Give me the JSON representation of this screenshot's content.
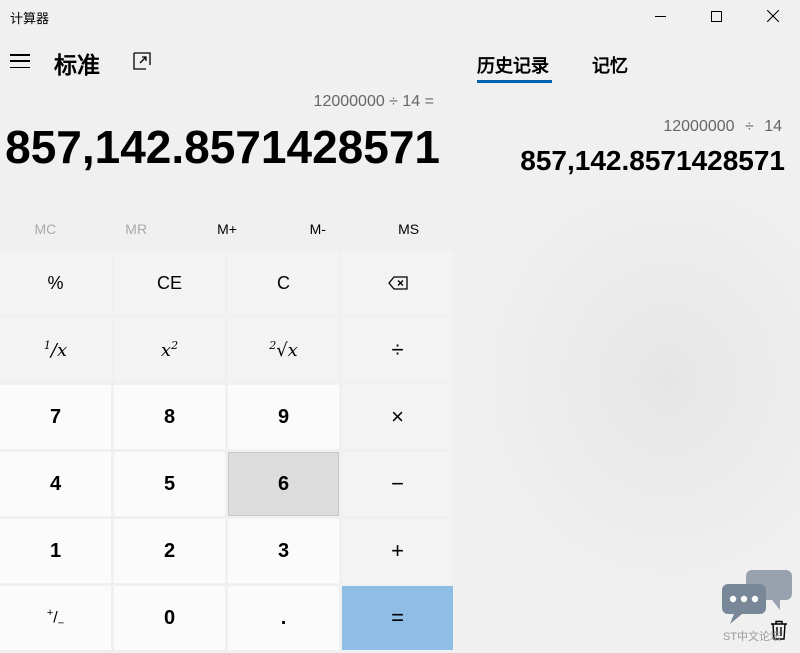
{
  "app": {
    "title": "计算器"
  },
  "header": {
    "mode": "标准"
  },
  "display": {
    "expression": "12000000 ÷ 14 =",
    "result": "857,142.8571428571"
  },
  "memory": {
    "mc": "MC",
    "mr": "MR",
    "mplus": "M+",
    "mminus": "M-",
    "ms": "MS"
  },
  "keys": {
    "percent": "%",
    "ce": "CE",
    "c": "C",
    "divide": "÷",
    "multiply": "×",
    "minus": "−",
    "plus": "+",
    "equals": "=",
    "d7": "7",
    "d8": "8",
    "d9": "9",
    "d4": "4",
    "d5": "5",
    "d6": "6",
    "d1": "1",
    "d2": "2",
    "d3": "3",
    "d0": "0",
    "decimal": "."
  },
  "panel": {
    "tabs": [
      "历史记录",
      "记忆"
    ],
    "history": [
      {
        "expression": "12000000 ÷ 14",
        "result": "857,142.8571428571"
      }
    ]
  },
  "overlay": {
    "label": "ST中文论坛"
  },
  "colors": {
    "accent": "#0063b1",
    "equals_bg": "#8ebde6"
  },
  "icons": [
    "menu-icon",
    "keep-on-top-icon",
    "backspace-icon",
    "trash-icon",
    "chat-bubble-icon"
  ]
}
